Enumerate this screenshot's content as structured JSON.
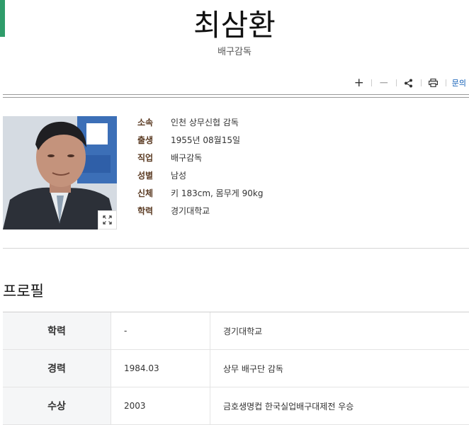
{
  "header": {
    "title": "최삼환",
    "subtitle": "배구감독"
  },
  "toolbar": {
    "plus_label": "+",
    "minus_label": "−",
    "inquiry_label": "문의"
  },
  "info": {
    "rows": [
      {
        "label": "소속",
        "value": "인천 상무신협 감독"
      },
      {
        "label": "출생",
        "value": "1955년 08월15일"
      },
      {
        "label": "직업",
        "value": "배구감독"
      },
      {
        "label": "성별",
        "value": "남성"
      },
      {
        "label": "신체",
        "value": "키 183cm, 몸무게 90kg"
      },
      {
        "label": "학력",
        "value": "경기대학교"
      }
    ]
  },
  "profile": {
    "title": "프로필",
    "rows": [
      {
        "category": "학력",
        "year": "-",
        "content": "경기대학교"
      },
      {
        "category": "경력",
        "year": "1984.03",
        "content": "상무 배구단 감독"
      },
      {
        "category": "수상",
        "year": "2003",
        "content": "금호생명컵 한국실업배구대제전 우승"
      }
    ]
  },
  "colors": {
    "accent": "#2f9c6a",
    "label": "#5a3a22",
    "link": "#0b5bb5"
  },
  "icons": [
    "plus-icon",
    "minus-icon",
    "share-icon",
    "print-icon",
    "expand-icon"
  ]
}
